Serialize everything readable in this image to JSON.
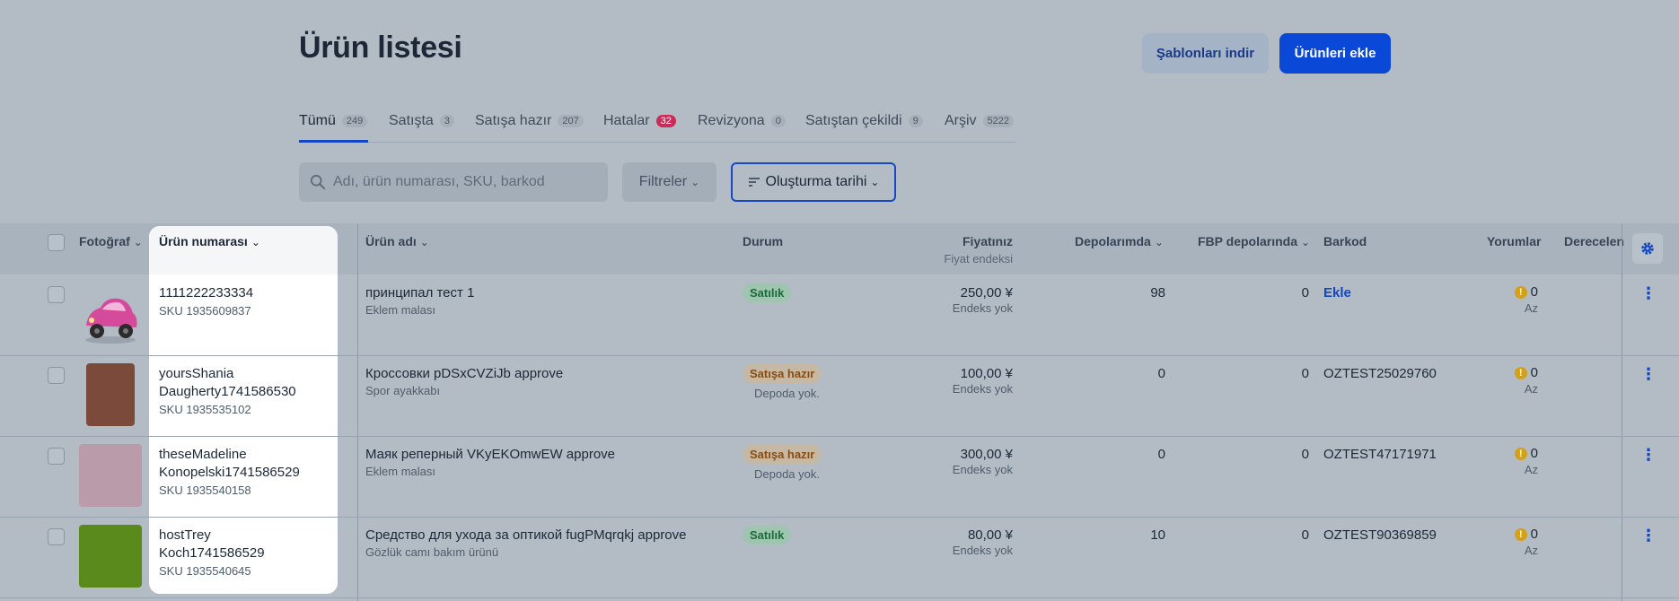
{
  "page": {
    "title": "Ürün listesi"
  },
  "actions": {
    "download_templates": "Şablonları indir",
    "add_products": "Ürünleri ekle"
  },
  "tabs": [
    {
      "label": "Tümü",
      "count": "249"
    },
    {
      "label": "Satışta",
      "count": "3"
    },
    {
      "label": "Satışa hazır",
      "count": "207"
    },
    {
      "label": "Hatalar",
      "count": "32"
    },
    {
      "label": "Revizyona",
      "count": "0"
    },
    {
      "label": "Satıştan çekildi",
      "count": "9"
    },
    {
      "label": "Arşiv",
      "count": "5222"
    }
  ],
  "toolbar": {
    "search_placeholder": "Adı, ürün numarası, SKU, barkod",
    "filters_label": "Filtreler",
    "sort_label": "Oluşturma tarihi"
  },
  "columns": {
    "photo": "Fotoğraf",
    "product_number": "Ürün numarası",
    "product_name": "Ürün adı",
    "status": "Durum",
    "price": "Fiyatınız",
    "price_sub": "Fiyat endeksi",
    "warehouses": "Depolarımda",
    "fbp": "FBP depolarında",
    "barcode": "Barkod",
    "reviews": "Yorumlar",
    "ratings": "Derecelen"
  },
  "rows": [
    {
      "number": "1111222233334",
      "sku": "SKU 1935609837",
      "name": "принципал тест 1",
      "category": "Eklem malası",
      "status": "Satılık",
      "status_note": "",
      "price": "250,00 ¥",
      "price_index": "Endeks yok",
      "stock": "98",
      "fbp": "0",
      "barcode": "Ekle",
      "reviews": "0",
      "reviews_note": "Az",
      "thumb": "toy-car-image"
    },
    {
      "number": "yoursShania\nDaugherty1741586530",
      "sku": "SKU 1935535102",
      "name": "Кроссовки pDSxCVZiJb approve",
      "category": "Spor ayakkabı",
      "status": "Satışa hazır",
      "status_note": "Depoda yok.",
      "price": "100,00 ¥",
      "price_index": "Endeks yok",
      "stock": "0",
      "fbp": "0",
      "barcode": "OZTEST25029760",
      "reviews": "0",
      "reviews_note": "Az",
      "thumb": "brown-swatch"
    },
    {
      "number": "theseMadeline\nKonopelski1741586529",
      "sku": "SKU 1935540158",
      "name": "Маяк реперный VKyEKOmwEW approve",
      "category": "Eklem malası",
      "status": "Satışa hazır",
      "status_note": "Depoda yok.",
      "price": "300,00 ¥",
      "price_index": "Endeks yok",
      "stock": "0",
      "fbp": "0",
      "barcode": "OZTEST47171971",
      "reviews": "0",
      "reviews_note": "Az",
      "thumb": "pink-swatch"
    },
    {
      "number": "hostTrey\nKoch1741586529",
      "sku": "SKU 1935540645",
      "name": "Средство для ухода за оптикой fugPMqrqkj approve",
      "category": "Gözlük camı bakım ürünü",
      "status": "Satılık",
      "status_note": "",
      "price": "80,00 ¥",
      "price_index": "Endeks yok",
      "stock": "10",
      "fbp": "0",
      "barcode": "OZTEST90369859",
      "reviews": "0",
      "reviews_note": "Az",
      "thumb": "green-swatch"
    }
  ],
  "colors": {
    "primary": "#0a49d8",
    "error_badge": "#cc2a57",
    "overlay": "#b3bcc4"
  }
}
